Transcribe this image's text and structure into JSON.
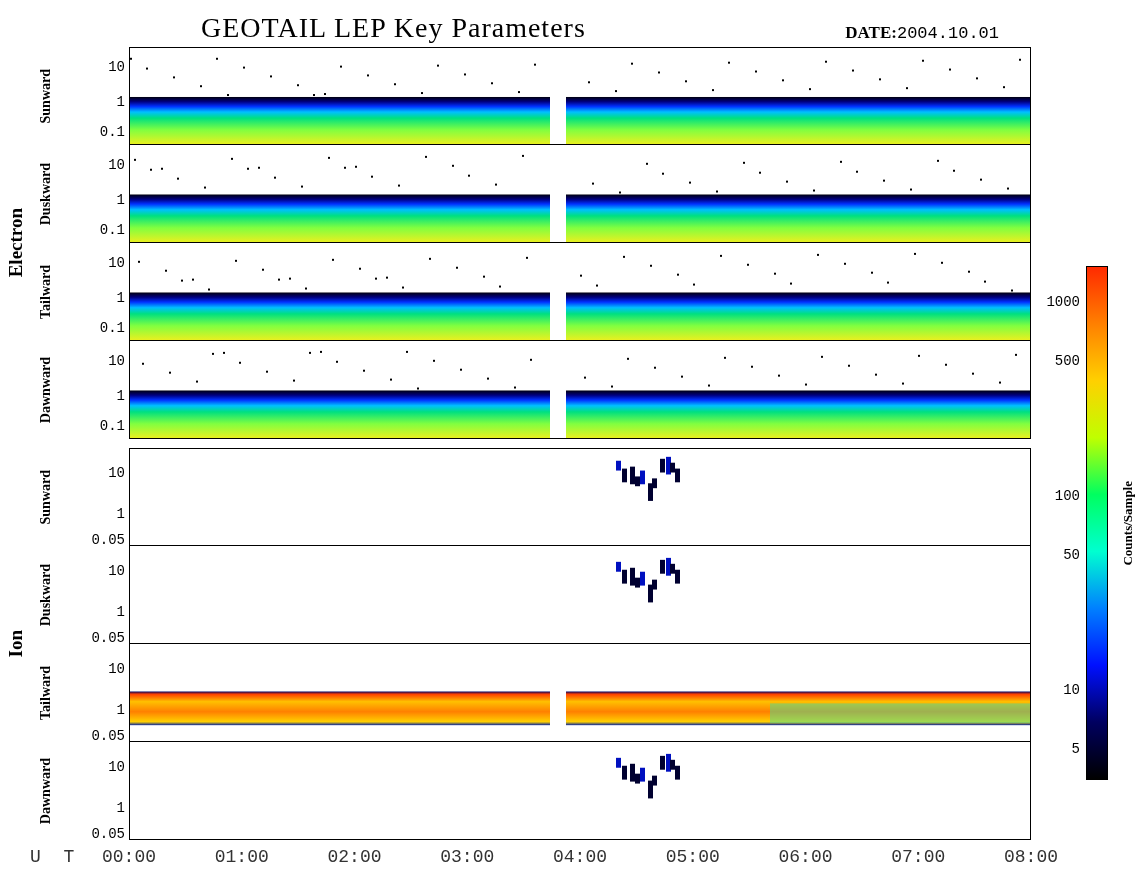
{
  "title": "GEOTAIL LEP Key Parameters",
  "date": {
    "label": "DATE:",
    "value": "2004.10.01"
  },
  "groups": [
    {
      "label": "Electron",
      "panels": [
        {
          "label": "Sunward",
          "kind": "electron",
          "yticks": [
            "10",
            "1",
            "0.1"
          ]
        },
        {
          "label": "Duskward",
          "kind": "electron",
          "yticks": [
            "10",
            "1",
            "0.1"
          ]
        },
        {
          "label": "Tailward",
          "kind": "electron",
          "yticks": [
            "10",
            "1",
            "0.1"
          ]
        },
        {
          "label": "Dawnward",
          "kind": "electron",
          "yticks": [
            "10",
            "1",
            "0.1"
          ]
        }
      ]
    },
    {
      "label": "Ion",
      "panels": [
        {
          "label": "Sunward",
          "kind": "ion-sparse",
          "yticks": [
            "10",
            "1",
            "0.05"
          ]
        },
        {
          "label": "Duskward",
          "kind": "ion-sparse",
          "yticks": [
            "10",
            "1",
            "0.05"
          ]
        },
        {
          "label": "Tailward",
          "kind": "ion-band",
          "yticks": [
            "10",
            "1",
            "0.05"
          ]
        },
        {
          "label": "Dawnward",
          "kind": "ion-sparse",
          "yticks": [
            "10",
            "1",
            "0.05"
          ]
        }
      ]
    }
  ],
  "colorbar": {
    "label": "Counts/Sample",
    "ticks": [
      "1000",
      "500",
      "100",
      "50",
      "10",
      "5"
    ]
  },
  "xaxis": {
    "label": "U T",
    "ticks": [
      "00:00",
      "01:00",
      "02:00",
      "03:00",
      "04:00",
      "05:00",
      "06:00",
      "07:00",
      "08:00"
    ]
  }
}
